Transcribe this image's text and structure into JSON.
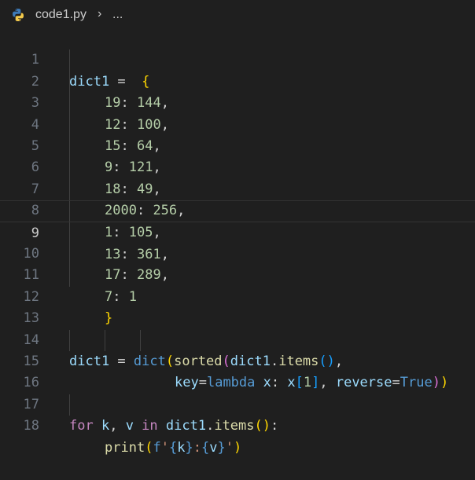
{
  "breadcrumb": {
    "file_icon": "python-icon",
    "filename": "code1.py",
    "separator": "›",
    "more": "..."
  },
  "editor": {
    "line_numbers": [
      "1",
      "2",
      "3",
      "4",
      "5",
      "6",
      "7",
      "8",
      "9",
      "10",
      "11",
      "12",
      "13",
      "14",
      "15",
      "16",
      "17",
      "18"
    ],
    "current_line": 9,
    "lines": {
      "l1": {
        "name": "dict1",
        "eq": " =  ",
        "brace": "{"
      },
      "l2": {
        "key": "19",
        "colon": ": ",
        "val": "144",
        "comma": ","
      },
      "l3": {
        "key": "12",
        "colon": ": ",
        "val": "100",
        "comma": ","
      },
      "l4": {
        "key": "15",
        "colon": ": ",
        "val": "64",
        "comma": ","
      },
      "l5": {
        "key": "9",
        "colon": ": ",
        "val": "121",
        "comma": ","
      },
      "l6": {
        "key": "18",
        "colon": ": ",
        "val": "49",
        "comma": ","
      },
      "l7": {
        "key": "2000",
        "colon": ": ",
        "val": "256",
        "comma": ","
      },
      "l8": {
        "key": "1",
        "colon": ": ",
        "val": "105",
        "comma": ","
      },
      "l9": {
        "key": "13",
        "colon": ": ",
        "val": "361",
        "comma": ","
      },
      "l10": {
        "key": "17",
        "colon": ": ",
        "val": "289",
        "comma": ","
      },
      "l11": {
        "key": "7",
        "colon": ": ",
        "val": "1"
      },
      "l12": {
        "brace": "}"
      },
      "l14": {
        "name": "dict1",
        "eq": " = ",
        "dict": "dict",
        "p1": "(",
        "sorted": "sorted",
        "p2": "(",
        "obj": "dict1",
        "dot": ".",
        "items": "items",
        "p3": "()",
        "comma": ","
      },
      "l15": {
        "key": "key",
        "eq": "=",
        "lambda": "lambda",
        "x1": " x",
        "colon": ": ",
        "x2": "x",
        "b1": "[",
        "one": "1",
        "b2": "]",
        "comma": ", ",
        "reverse": "reverse",
        "eq2": "=",
        "true": "True",
        "p2": ")",
        "p1": ")"
      },
      "l17": {
        "for": "for",
        "k": " k",
        "comma": ", ",
        "v": "v",
        "in": " in ",
        "obj": "dict1",
        "dot": ".",
        "items": "items",
        "p": "()",
        "colon": ":"
      },
      "l18": {
        "print": "print",
        "p1": "(",
        "f": "f",
        "q1": "'",
        "b1": "{",
        "k": "k",
        "b2": "}",
        "colon": ":",
        "b3": "{",
        "v": "v",
        "b4": "}",
        "q2": "'",
        "p2": ")"
      }
    }
  }
}
